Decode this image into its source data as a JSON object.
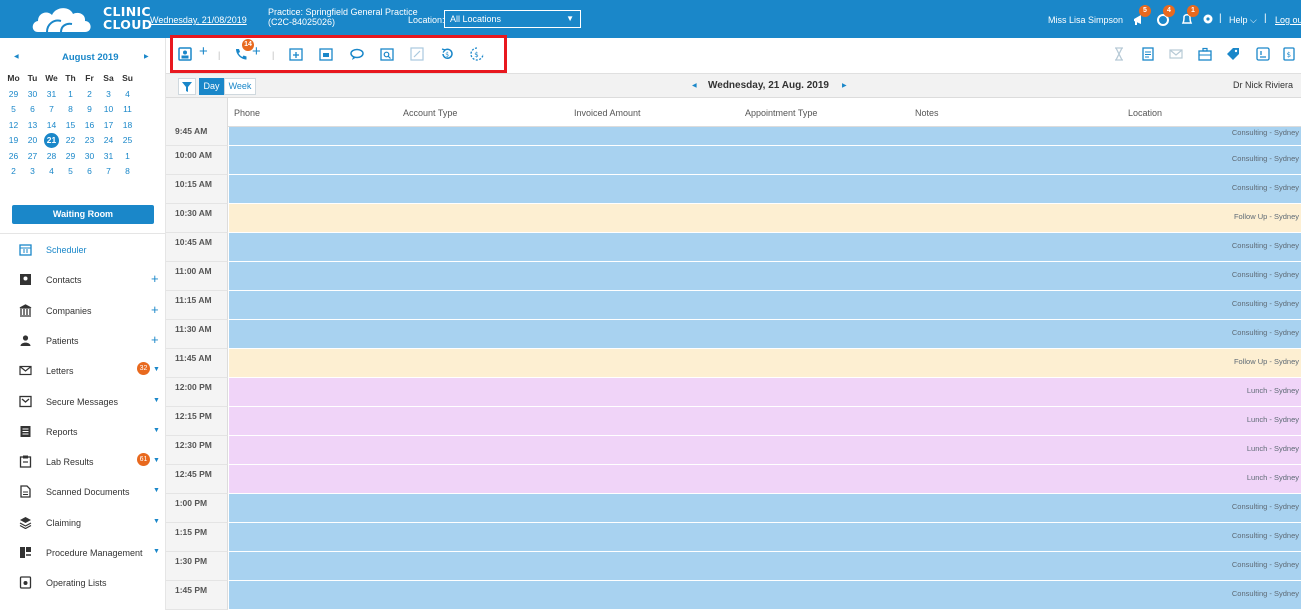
{
  "header": {
    "logo_text_line1": "CLINIC",
    "logo_text_line2": "CLOUD",
    "date_link": "Wednesday, 21/08/2019",
    "practice_line1": "Practice: Springfield General Practice",
    "practice_line2": "(C2C-84025026)",
    "location_label": "Location:",
    "location_value": "All Locations",
    "user_name": "Miss Lisa Simpson",
    "badges": {
      "notifications": "5",
      "tasks": "4",
      "alerts": "1"
    },
    "help_label": "Help",
    "logout_label": "Log out",
    "colors": {
      "primary": "#1a87c9",
      "badge": "#e8691e"
    }
  },
  "calendar": {
    "month_title": "August 2019",
    "weekdays": [
      "Mo",
      "Tu",
      "We",
      "Th",
      "Fr",
      "Sa",
      "Su"
    ],
    "weeks": [
      [
        "29",
        "30",
        "31",
        "1",
        "2",
        "3",
        "4"
      ],
      [
        "5",
        "6",
        "7",
        "8",
        "9",
        "10",
        "11"
      ],
      [
        "12",
        "13",
        "14",
        "15",
        "16",
        "17",
        "18"
      ],
      [
        "19",
        "20",
        "21",
        "22",
        "23",
        "24",
        "25"
      ],
      [
        "26",
        "27",
        "28",
        "29",
        "30",
        "31",
        "1"
      ],
      [
        "2",
        "3",
        "4",
        "5",
        "6",
        "7",
        "8"
      ]
    ],
    "selected_day": "21"
  },
  "waiting_room_label": "Waiting Room",
  "nav": [
    {
      "label": "Scheduler",
      "icon": "calendar-icon",
      "active": true
    },
    {
      "label": "Contacts",
      "icon": "contact-card-icon",
      "plus": true
    },
    {
      "label": "Companies",
      "icon": "building-icon",
      "plus": true
    },
    {
      "label": "Patients",
      "icon": "person-icon",
      "plus": true
    },
    {
      "label": "Letters",
      "icon": "envelope-icon",
      "badge": "32",
      "caret": true
    },
    {
      "label": "Secure Messages",
      "icon": "secure-mail-icon",
      "caret": true
    },
    {
      "label": "Reports",
      "icon": "report-icon",
      "caret": true
    },
    {
      "label": "Lab Results",
      "icon": "clipboard-icon",
      "badge": "61",
      "caret": true
    },
    {
      "label": "Scanned Documents",
      "icon": "document-icon",
      "caret": true
    },
    {
      "label": "Claiming",
      "icon": "layers-icon",
      "caret": true
    },
    {
      "label": "Procedure Management",
      "icon": "procedure-icon",
      "caret": true
    },
    {
      "label": "Operating Lists",
      "icon": "operating-list-icon"
    }
  ],
  "toolbar": {
    "phone_badge": "14",
    "left_icons": [
      "patient-card-icon",
      "add-icon",
      "phone-icon",
      "add-icon",
      "add-appointment-icon",
      "calendar-range-icon",
      "chat-icon",
      "calendar-search-icon",
      "edit-icon",
      "history-icon",
      "billing-icon"
    ],
    "right_icons": [
      "hourglass-icon",
      "document-icon",
      "envelope-icon",
      "briefcase-icon",
      "tag-icon",
      "invoice-icon",
      "receipt-icon",
      "receipt-icon"
    ]
  },
  "viewbar": {
    "day_label": "Day",
    "week_label": "Week",
    "current_date": "Wednesday, 21 Aug. 2019",
    "doctor": "Dr Nick Riviera"
  },
  "columns": [
    "Phone",
    "Account Type",
    "Invoiced Amount",
    "Appointment Type",
    "Notes",
    "Location"
  ],
  "schedule": [
    {
      "time": "9:45 AM",
      "type": "consult",
      "label": "Consulting - Sydney"
    },
    {
      "time": "10:00 AM",
      "type": "consult",
      "label": "Consulting - Sydney"
    },
    {
      "time": "10:15 AM",
      "type": "consult",
      "label": "Consulting - Sydney"
    },
    {
      "time": "10:30 AM",
      "type": "follow",
      "label": "Follow Up - Sydney"
    },
    {
      "time": "10:45 AM",
      "type": "consult",
      "label": "Consulting - Sydney"
    },
    {
      "time": "11:00 AM",
      "type": "consult",
      "label": "Consulting - Sydney"
    },
    {
      "time": "11:15 AM",
      "type": "consult",
      "label": "Consulting - Sydney"
    },
    {
      "time": "11:30 AM",
      "type": "consult",
      "label": "Consulting - Sydney"
    },
    {
      "time": "11:45 AM",
      "type": "follow",
      "label": "Follow Up - Sydney"
    },
    {
      "time": "12:00 PM",
      "type": "lunch",
      "label": "Lunch - Sydney"
    },
    {
      "time": "12:15 PM",
      "type": "lunch",
      "label": "Lunch - Sydney"
    },
    {
      "time": "12:30 PM",
      "type": "lunch",
      "label": "Lunch - Sydney"
    },
    {
      "time": "12:45 PM",
      "type": "lunch",
      "label": "Lunch - Sydney"
    },
    {
      "time": "1:00 PM",
      "type": "consult",
      "label": "Consulting - Sydney"
    },
    {
      "time": "1:15 PM",
      "type": "consult",
      "label": "Consulting - Sydney"
    },
    {
      "time": "1:30 PM",
      "type": "consult",
      "label": "Consulting - Sydney"
    },
    {
      "time": "1:45 PM",
      "type": "consult",
      "label": "Consulting - Sydney"
    }
  ],
  "slot_colors": {
    "consult": "#a8d2f0",
    "follow": "#fdefd2",
    "lunch": "#f0d4f8"
  }
}
